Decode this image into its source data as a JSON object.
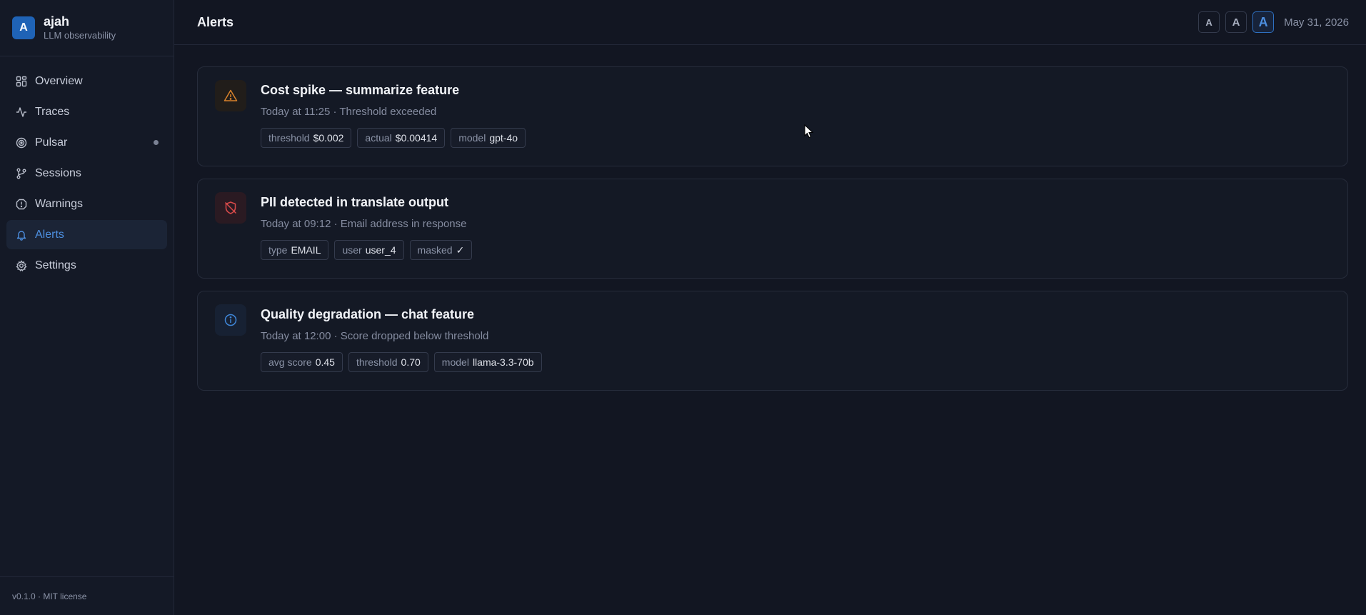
{
  "brand": {
    "initial": "A",
    "name": "ajah",
    "subtitle": "LLM observability"
  },
  "nav": [
    {
      "label": "Overview",
      "icon": "grid-icon"
    },
    {
      "label": "Traces",
      "icon": "activity-icon"
    },
    {
      "label": "Pulsar",
      "icon": "radar-icon"
    },
    {
      "label": "Sessions",
      "icon": "git-branch-icon"
    },
    {
      "label": "Warnings",
      "icon": "alert-octagon-icon"
    },
    {
      "label": "Alerts",
      "icon": "bell-icon",
      "active": true
    },
    {
      "label": "Settings",
      "icon": "gear-icon"
    }
  ],
  "footer": "v0.1.0 · MIT license",
  "header": {
    "title": "Alerts",
    "font_sizes": [
      "A",
      "A",
      "A"
    ],
    "date": "May 31, 2026"
  },
  "alerts": [
    {
      "title": "Cost spike — summarize feature",
      "meta": "Today at 11:25 · Threshold exceeded",
      "severity": "warning",
      "icon": "warning-triangle-icon",
      "tags": [
        {
          "k": "threshold",
          "v": "$0.002"
        },
        {
          "k": "actual",
          "v": "$0.00414"
        },
        {
          "k": "model",
          "v": "gpt-4o"
        }
      ]
    },
    {
      "title": "PII detected in translate output",
      "meta": "Today at 09:12 · Email address in response",
      "severity": "danger",
      "icon": "shield-off-icon",
      "tags": [
        {
          "k": "type",
          "v": "EMAIL"
        },
        {
          "k": "user",
          "v": "user_4"
        },
        {
          "k": "masked",
          "v": "✓"
        }
      ]
    },
    {
      "title": "Quality degradation — chat feature",
      "meta": "Today at 12:00 · Score dropped below threshold",
      "severity": "info",
      "icon": "info-icon",
      "tags": [
        {
          "k": "avg score",
          "v": "0.45"
        },
        {
          "k": "threshold",
          "v": "0.70"
        },
        {
          "k": "model",
          "v": "llama-3.3-70b"
        }
      ]
    }
  ],
  "colors": {
    "accent": "#4d8fe0",
    "warning": "#d9822b",
    "danger": "#d94a4a",
    "info": "#3f86d8",
    "background": "#121622",
    "sidebar": "#141926"
  }
}
